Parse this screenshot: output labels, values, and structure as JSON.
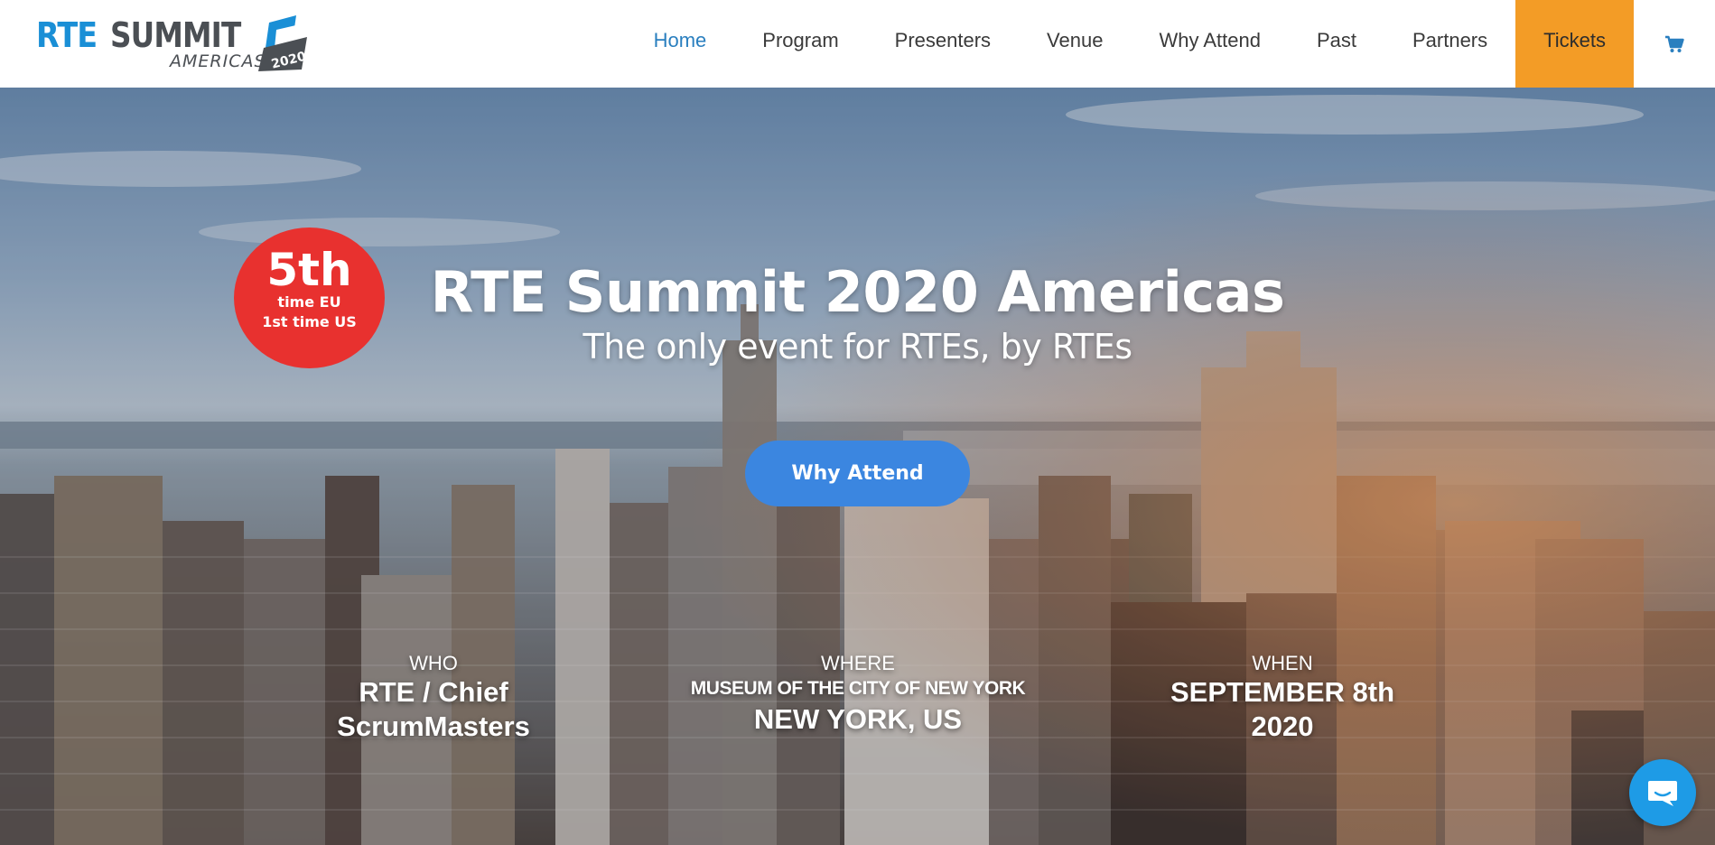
{
  "logo": {
    "word1": "RTE",
    "word2": "SUMMIT",
    "region": "AMERICAS",
    "year": "2020"
  },
  "nav": {
    "items": [
      {
        "label": "Home",
        "active": true
      },
      {
        "label": "Program"
      },
      {
        "label": "Presenters"
      },
      {
        "label": "Venue"
      },
      {
        "label": "Why Attend"
      },
      {
        "label": "Past"
      },
      {
        "label": "Partners"
      },
      {
        "label": "Tickets",
        "highlight": "#f39c26"
      }
    ],
    "cart_icon": "shopping-cart-icon"
  },
  "hero": {
    "badge": {
      "big": "5th",
      "line1": "time EU",
      "line2": "1st time US"
    },
    "title": "RTE Summit 2020 Americas",
    "subtitle": "The only event for RTEs, by RTEs",
    "cta": "Why Attend",
    "who": {
      "label": "WHO",
      "line1": "RTE / Chief",
      "line2": "ScrumMasters"
    },
    "where": {
      "label": "WHERE",
      "venue": "MUSEUM OF THE CITY OF NEW YORK",
      "city": "NEW YORK, US"
    },
    "when": {
      "label": "WHEN",
      "line1": "SEPTEMBER 8th",
      "line2": "2020"
    }
  },
  "chat_icon": "chat-bubble-icon",
  "colors": {
    "accent": "#2a7fbf",
    "tickets": "#f39c26",
    "cta": "#3b86e0",
    "badge": "#e8312f",
    "chat": "#1e9be6"
  }
}
